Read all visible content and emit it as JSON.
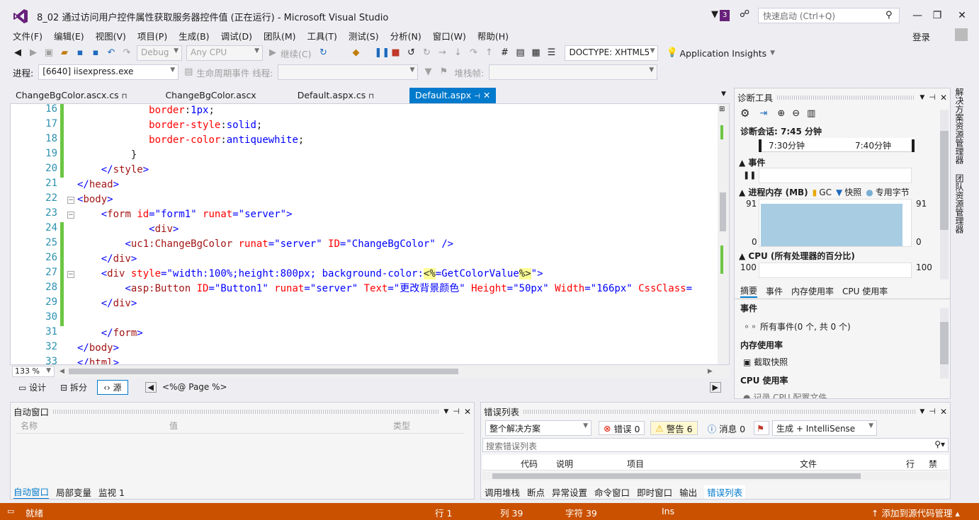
{
  "window": {
    "title": "8_02 通过访问用户控件属性获取服务器控件值 (正在运行) - Microsoft Visual Studio",
    "notification_count": "3",
    "quick_launch_placeholder": "快速启动 (Ctrl+Q)",
    "login": "登录"
  },
  "menu": [
    "文件(F)",
    "编辑(E)",
    "视图(V)",
    "项目(P)",
    "生成(B)",
    "调试(D)",
    "团队(M)",
    "工具(T)",
    "测试(S)",
    "分析(N)",
    "窗口(W)",
    "帮助(H)"
  ],
  "toolbar": {
    "config": "Debug",
    "platform": "Any CPU",
    "continue": "继续(C)",
    "doctype": "DOCTYPE: XHTML5",
    "insights": "Application Insights"
  },
  "debugbar": {
    "process_label": "进程:",
    "process_value": "[6640] iisexpress.exe",
    "lifecycle": "生命周期事件",
    "thread_label": "线程:",
    "stack_label": "堆栈帧:"
  },
  "tabs": [
    {
      "label": "ChangeBgColor.ascx.cs",
      "pin": true
    },
    {
      "label": "ChangeBgColor.ascx",
      "pin": false
    },
    {
      "label": "Default.aspx.cs",
      "pin": true
    },
    {
      "label": "Default.aspx",
      "pin": true
    }
  ],
  "editor": {
    "lines": [
      {
        "n": "16",
        "seg": [
          [
            "pl",
            "            "
          ],
          [
            "at",
            "border"
          ],
          [
            "pl",
            ":"
          ],
          [
            "vl",
            "1px"
          ],
          [
            "pl",
            ";"
          ]
        ],
        "chg": true
      },
      {
        "n": "17",
        "seg": [
          [
            "pl",
            "            "
          ],
          [
            "at",
            "border-style"
          ],
          [
            "pl",
            ":"
          ],
          [
            "vl",
            "solid"
          ],
          [
            "pl",
            ";"
          ]
        ],
        "chg": true
      },
      {
        "n": "18",
        "seg": [
          [
            "pl",
            "            "
          ],
          [
            "at",
            "border-color"
          ],
          [
            "pl",
            ":"
          ],
          [
            "vl",
            "antiquewhite"
          ],
          [
            "pl",
            ";"
          ]
        ],
        "chg": true
      },
      {
        "n": "19",
        "seg": [
          [
            "pl",
            "         }"
          ]
        ],
        "chg": true
      },
      {
        "n": "20",
        "seg": [
          [
            "pl",
            "    "
          ],
          [
            "br",
            "</"
          ],
          [
            "tg",
            "style"
          ],
          [
            "br",
            ">"
          ]
        ],
        "chg": true
      },
      {
        "n": "21",
        "seg": [
          [
            "br",
            "</"
          ],
          [
            "tg",
            "head"
          ],
          [
            "br",
            ">"
          ]
        ],
        "chg": false
      },
      {
        "n": "22",
        "seg": [
          [
            "br",
            "<"
          ],
          [
            "tg",
            "body"
          ],
          [
            "br",
            ">"
          ]
        ],
        "chg": false,
        "fold": true
      },
      {
        "n": "23",
        "seg": [
          [
            "pl",
            "    "
          ],
          [
            "br",
            "<"
          ],
          [
            "tg",
            "form "
          ],
          [
            "at",
            "id"
          ],
          [
            "br",
            "=\""
          ],
          [
            "vl",
            "form1"
          ],
          [
            "br",
            "\" "
          ],
          [
            "at",
            "runat"
          ],
          [
            "br",
            "=\""
          ],
          [
            "vl",
            "server"
          ],
          [
            "br",
            "\">"
          ]
        ],
        "chg": false,
        "fold": true
      },
      {
        "n": "24",
        "seg": [
          [
            "pl",
            "            "
          ],
          [
            "br",
            "<"
          ],
          [
            "tg",
            "div"
          ],
          [
            "br",
            ">"
          ]
        ],
        "chg": true
      },
      {
        "n": "25",
        "seg": [
          [
            "pl",
            "        "
          ],
          [
            "br",
            "<"
          ],
          [
            "tg",
            "uc1:ChangeBgColor "
          ],
          [
            "at",
            "runat"
          ],
          [
            "br",
            "=\""
          ],
          [
            "vl",
            "server"
          ],
          [
            "br",
            "\" "
          ],
          [
            "at",
            "ID"
          ],
          [
            "br",
            "=\""
          ],
          [
            "vl",
            "ChangeBgColor"
          ],
          [
            "br",
            "\" />"
          ]
        ],
        "chg": true
      },
      {
        "n": "26",
        "seg": [
          [
            "pl",
            "    "
          ],
          [
            "br",
            "</"
          ],
          [
            "tg",
            "div"
          ],
          [
            "br",
            ">"
          ]
        ],
        "chg": true
      },
      {
        "n": "27",
        "seg": [
          [
            "pl",
            "    "
          ],
          [
            "br",
            "<"
          ],
          [
            "tg",
            "div "
          ],
          [
            "at",
            "style"
          ],
          [
            "br",
            "=\""
          ],
          [
            "vl",
            "width:100%;height:800px; background-color:"
          ],
          [
            "hl",
            "<%"
          ],
          [
            "vl",
            "=GetColorValue"
          ],
          [
            "hl",
            "%>"
          ],
          [
            "br",
            "\">"
          ]
        ],
        "chg": true,
        "fold": true
      },
      {
        "n": "28",
        "seg": [
          [
            "pl",
            "        "
          ],
          [
            "br",
            "<"
          ],
          [
            "tg",
            "asp:Button "
          ],
          [
            "at",
            "ID"
          ],
          [
            "br",
            "=\""
          ],
          [
            "vl",
            "Button1"
          ],
          [
            "br",
            "\" "
          ],
          [
            "at",
            "runat"
          ],
          [
            "br",
            "=\""
          ],
          [
            "vl",
            "server"
          ],
          [
            "br",
            "\" "
          ],
          [
            "at",
            "Text"
          ],
          [
            "br",
            "=\""
          ],
          [
            "vl",
            "更改背景颜色"
          ],
          [
            "br",
            "\" "
          ],
          [
            "at",
            "Height"
          ],
          [
            "br",
            "=\""
          ],
          [
            "vl",
            "50px"
          ],
          [
            "br",
            "\" "
          ],
          [
            "at",
            "Width"
          ],
          [
            "br",
            "=\""
          ],
          [
            "vl",
            "166px"
          ],
          [
            "br",
            "\" "
          ],
          [
            "at",
            "CssClass"
          ],
          [
            "br",
            "="
          ]
        ],
        "chg": true
      },
      {
        "n": "29",
        "seg": [
          [
            "pl",
            "    "
          ],
          [
            "br",
            "</"
          ],
          [
            "tg",
            "div"
          ],
          [
            "br",
            ">"
          ]
        ],
        "chg": true
      },
      {
        "n": "30",
        "seg": [
          [
            "pl",
            ""
          ]
        ],
        "chg": true
      },
      {
        "n": "31",
        "seg": [
          [
            "pl",
            "    "
          ],
          [
            "br",
            "</"
          ],
          [
            "tg",
            "form"
          ],
          [
            "br",
            ">"
          ]
        ],
        "chg": false
      },
      {
        "n": "32",
        "seg": [
          [
            "br",
            "</"
          ],
          [
            "tg",
            "body"
          ],
          [
            "br",
            ">"
          ]
        ],
        "chg": false
      },
      {
        "n": "33",
        "seg": [
          [
            "br",
            "</"
          ],
          [
            "tg",
            "html"
          ],
          [
            "br",
            ">"
          ]
        ],
        "chg": false
      }
    ],
    "zoom": "133 %",
    "view_design": "设计",
    "view_split": "拆分",
    "view_source": "源",
    "breadcrumb": "<%@ Page %>"
  },
  "diagnostics": {
    "title": "诊断工具",
    "session": "诊断会话: 7:45 分钟",
    "t1": "7:30分钟",
    "t2": "7:40分钟",
    "events": "事件",
    "memory": "进程内存 (MB)",
    "gc": "GC",
    "snapshot": "快照",
    "private_bytes": "专用字节",
    "mem_max": "91",
    "mem_min": "0",
    "cpu": "CPU (所有处理器的百分比)",
    "cpu_max": "100",
    "tabs": [
      "摘要",
      "事件",
      "内存使用率",
      "CPU 使用率"
    ],
    "summary_events": "事件",
    "all_events": "所有事件(0 个, 共 0 个)",
    "memory_usage": "内存使用率",
    "take_snapshot": "截取快照",
    "cpu_usage": "CPU 使用率",
    "cpu_record": "记录 CPU 配置文件"
  },
  "sidebar": [
    "解决方案资源管理器",
    "团队资源管理器"
  ],
  "autos": {
    "title": "自动窗口",
    "col_name": "名称",
    "col_value": "值",
    "col_type": "类型",
    "tabs": [
      "自动窗口",
      "局部变量",
      "监视 1"
    ]
  },
  "errors": {
    "title": "错误列表",
    "scope": "整个解决方案",
    "errors_btn": "错误 0",
    "warnings_btn": "警告 6",
    "messages_btn": "消息 0",
    "build_filter": "生成 + IntelliSense",
    "search_placeholder": "搜索错误列表",
    "col_code": "代码",
    "col_desc": "说明",
    "col_project": "项目",
    "col_file": "文件",
    "col_line": "行",
    "col_suppress": "禁",
    "tabs": [
      "调用堆栈",
      "断点",
      "异常设置",
      "命令窗口",
      "即时窗口",
      "输出",
      "错误列表"
    ]
  },
  "status": {
    "ready": "就绪",
    "line": "行 1",
    "col": "列 39",
    "char": "字符 39",
    "ins": "Ins",
    "source_control": "添加到源代码管理"
  },
  "colors": {
    "accent": "#007ACC",
    "status": "#CA5100",
    "vs_purple": "#68217A"
  }
}
